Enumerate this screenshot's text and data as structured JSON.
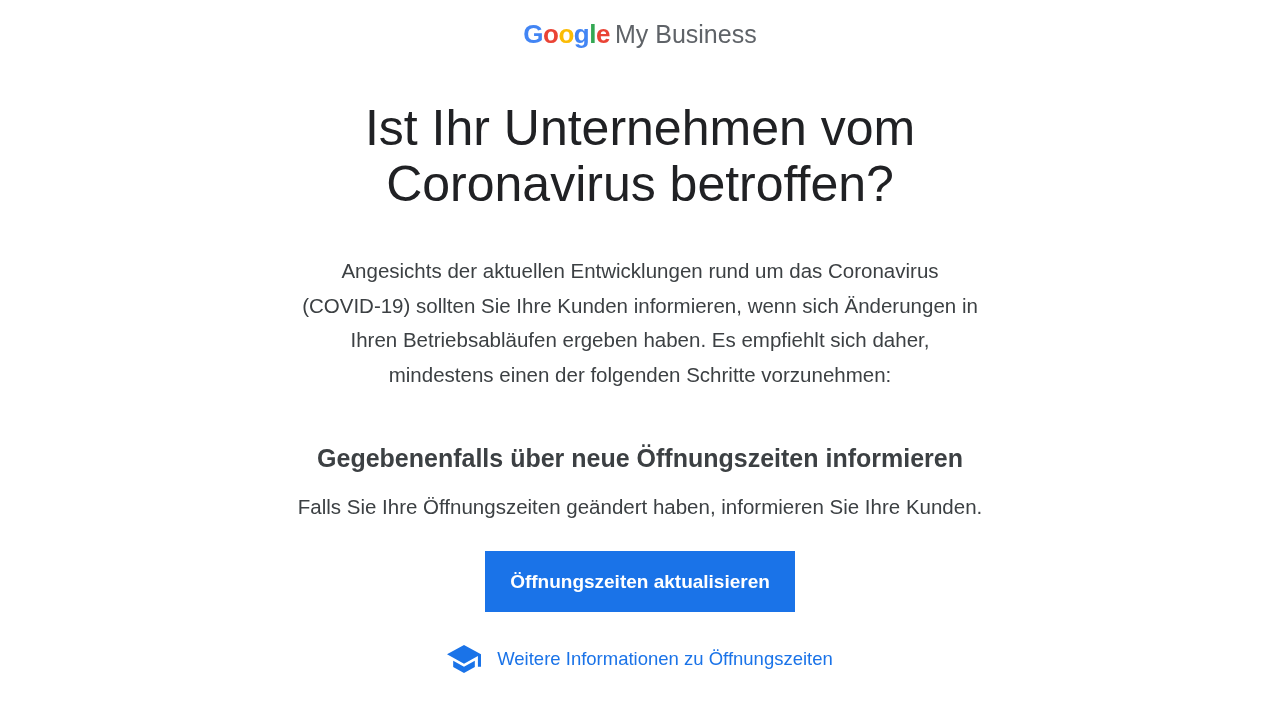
{
  "logo": {
    "brand": "Google",
    "product": "My Business"
  },
  "heading": "Ist Ihr Unternehmen vom Coronavirus betroffen?",
  "intro": "Angesichts der aktuellen Entwicklungen rund um das Coronavirus (COVID-19) sollten Sie Ihre Kunden informieren, wenn sich Änderungen in Ihren Betriebsabläufen ergeben haben. Es empfiehlt sich daher, mindestens einen der folgenden Schritte vorzunehmen:",
  "section": {
    "title": "Gegebenenfalls über neue Öffnungszeiten informieren",
    "text": "Falls Sie Ihre Öffnungszeiten geändert haben, informieren Sie Ihre Kunden.",
    "button": "Öffnungszeiten aktualisieren",
    "link": "Weitere Informationen zu Öffnungszeiten"
  }
}
